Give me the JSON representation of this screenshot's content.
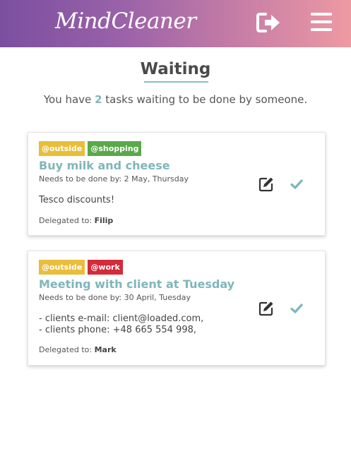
{
  "header": {
    "app_name": "MindCleaner",
    "logout_icon": "logout-icon",
    "menu_icon": "hamburger-menu-icon",
    "gradient": [
      "#7b4fa0",
      "#ee9aa3"
    ]
  },
  "page": {
    "title": "Waiting",
    "summary_prefix": "You have",
    "summary_count": "2",
    "summary_suffix": "tasks waiting to be done by someone."
  },
  "tasks": [
    {
      "tags": [
        "@outside",
        "@shopping"
      ],
      "tag_colors": [
        "#e8be3a",
        "#5aa84a"
      ],
      "title": "Buy milk and cheese",
      "due": "Needs to be done by: 2 May, Thursday",
      "description": [
        "Tesco discounts!"
      ],
      "delegated_label": "Delegated to:",
      "delegated_to": "Filip"
    },
    {
      "tags": [
        "@outside",
        "@work"
      ],
      "tag_colors": [
        "#e8be3a",
        "#d42a3a"
      ],
      "title": "Meeting with client at Tuesday",
      "due": "Needs to be done by: 30 April, Tuesday",
      "description": [
        "- clients e-mail: client@loaded.com,",
        "- clients phone: +48 665 554 998,"
      ],
      "delegated_label": "Delegated to:",
      "delegated_to": "Mark"
    }
  ],
  "colors": {
    "accent": "#7fb6ba",
    "text": "#444444"
  }
}
